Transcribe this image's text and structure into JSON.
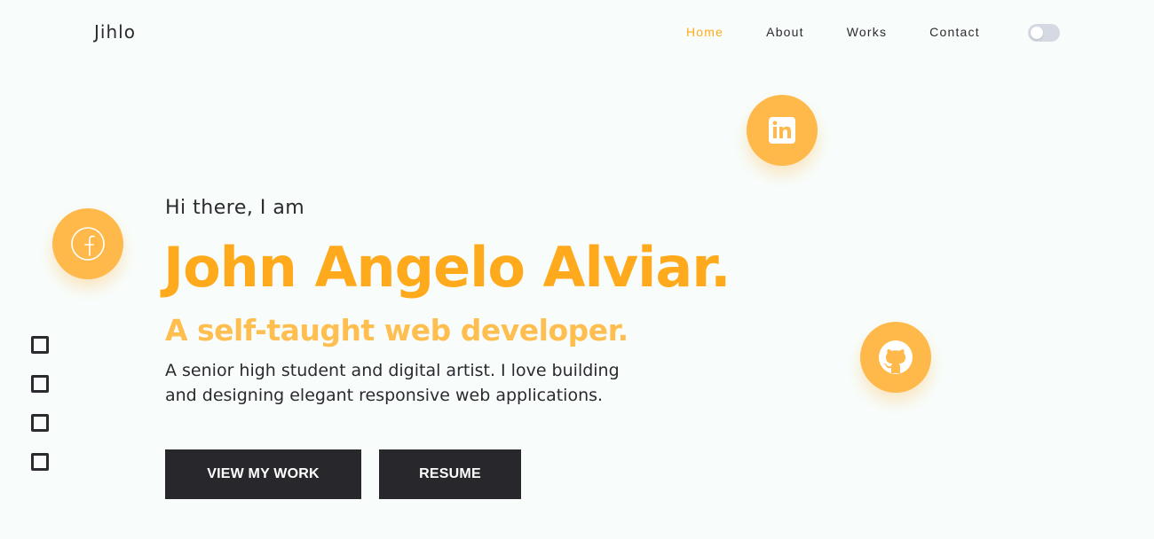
{
  "header": {
    "logo": "Jihlo",
    "nav": [
      {
        "label": "Home",
        "active": true
      },
      {
        "label": "About",
        "active": false
      },
      {
        "label": "Works",
        "active": false
      },
      {
        "label": "Contact",
        "active": false
      }
    ],
    "theme_toggle": {
      "on": false
    }
  },
  "social": {
    "linkedin": {
      "icon": "linkedin-icon"
    },
    "facebook": {
      "icon": "facebook-icon"
    },
    "github": {
      "icon": "github-icon"
    }
  },
  "hero": {
    "greeting": "Hi there, I am",
    "name": "John Angelo Alviar.",
    "tagline": "A self-taught web developer.",
    "bio_line1": "A senior high student and digital artist. I love building",
    "bio_line2": "and designing elegant responsive web applications.",
    "primary_button": "VIEW MY WORK",
    "secondary_button": "RESUME"
  },
  "section_indicators": {
    "count": 4
  },
  "colors": {
    "accent": "#ffaa1c",
    "accent_light": "#ffbe50",
    "social_bg": "#ffb84a",
    "dark": "#2b2a2f",
    "button_bg": "#28272c",
    "background": "#f8fdfc",
    "toggle_bg": "#d5d9e2"
  }
}
